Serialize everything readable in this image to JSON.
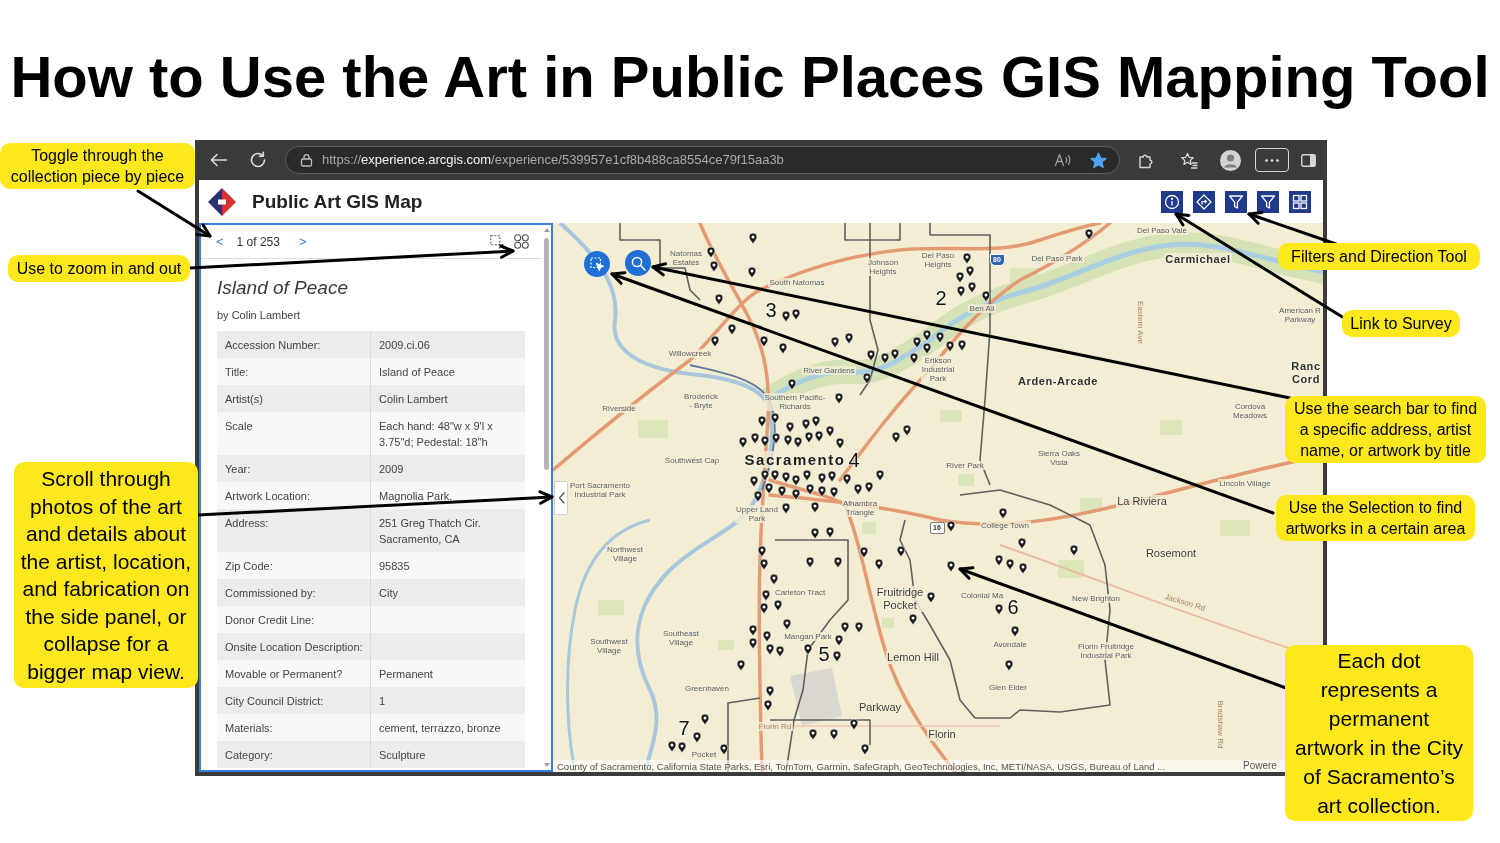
{
  "title": "How to Use the Art in Public Places GIS Mapping Tool",
  "browser": {
    "url": {
      "scheme": "https://",
      "host": "experience.arcgis.com",
      "path": "/experience/539957e1cf8b488ca8554ce79f15aa3b"
    },
    "bookmarked": true
  },
  "app": {
    "title": "Public Art GIS Map"
  },
  "panel": {
    "prev": "<",
    "position": "1 of 253",
    "next": ">",
    "artwork": {
      "title": "Island of Peace",
      "byline": "by Colin Lambert"
    },
    "fields": [
      {
        "label": "Accession Number:",
        "value": "2009.ci.06"
      },
      {
        "label": "Title:",
        "value": "Island of Peace"
      },
      {
        "label": "Artist(s)",
        "value": "Colin Lambert"
      },
      {
        "label": "Scale",
        "value": "Each hand: 48\"w x 9'l x 3.75\"d; Pedestal: 18\"h"
      },
      {
        "label": "Year:",
        "value": "2009"
      },
      {
        "label": "Artwork Location:",
        "value": "Magnolia Park."
      },
      {
        "label": "Address:",
        "value": "251 Greg Thatch Cir. Sacramento, CA"
      },
      {
        "label": "Zip Code:",
        "value": "95835"
      },
      {
        "label": "Commissioned by:",
        "value": "City"
      },
      {
        "label": "Donor Credit Line:"
      },
      {
        "label": "Onsite Location Description:"
      },
      {
        "label": "Movable or Permanent?",
        "value": "Permanent"
      },
      {
        "label": "City Council District:",
        "value": "1"
      },
      {
        "label": "Materials:",
        "value": "cement, terrazzo, bronze"
      },
      {
        "label": "Category:",
        "value": "Sculpture"
      }
    ]
  },
  "map": {
    "labels": [
      {
        "text": "Del Paso Vale",
        "kind": "place"
      },
      {
        "text": "Natomas Estates",
        "kind": "place"
      },
      {
        "text": "Johnson Heights",
        "kind": "place"
      },
      {
        "text": "Del Paso Heights",
        "kind": "place"
      },
      {
        "text": "80",
        "kind": "interstate"
      },
      {
        "text": "Del Paso Park",
        "kind": "place"
      },
      {
        "text": "Carmichael",
        "kind": "major"
      },
      {
        "text": "South Natomas",
        "kind": "place"
      },
      {
        "text": "3",
        "kind": "district"
      },
      {
        "text": "2",
        "kind": "district"
      },
      {
        "text": "Ben Ali",
        "kind": "place"
      },
      {
        "text": "Eastern Ave",
        "kind": "road"
      },
      {
        "text": "American R Parkway",
        "kind": "place"
      },
      {
        "text": "Willowcreek",
        "kind": "place"
      },
      {
        "text": "River Gardens",
        "kind": "place"
      },
      {
        "text": "Erikson Industrial Park",
        "kind": "place"
      },
      {
        "text": "Arden-Arcade",
        "kind": "major"
      },
      {
        "text": "Ranc Cord",
        "kind": "major"
      },
      {
        "text": "Riverside",
        "kind": "place"
      },
      {
        "text": "Broderick - Bryte",
        "kind": "place"
      },
      {
        "text": "Southern Pacific-Richards",
        "kind": "place"
      },
      {
        "text": "Cordova Meadows",
        "kind": "place"
      },
      {
        "text": "Southwest Cap",
        "kind": "place"
      },
      {
        "text": "Sacramento",
        "kind": "city"
      },
      {
        "text": "4",
        "kind": "district"
      },
      {
        "text": "River Park",
        "kind": "place"
      },
      {
        "text": "Sierra Oaks Vista",
        "kind": "place"
      },
      {
        "text": "Port Sacramento Industrial Park",
        "kind": "place"
      },
      {
        "text": "Lincoln Village",
        "kind": "place"
      },
      {
        "text": "Upper Land Park",
        "kind": "place"
      },
      {
        "text": "Alhambra Triangle",
        "kind": "place"
      },
      {
        "text": "La Riviera",
        "kind": "area"
      },
      {
        "text": "16",
        "kind": "route"
      },
      {
        "text": "College Town",
        "kind": "place"
      },
      {
        "text": "Northwest Village",
        "kind": "place"
      },
      {
        "text": "Rosemont",
        "kind": "area"
      },
      {
        "text": "Carleton Tract",
        "kind": "place"
      },
      {
        "text": "Fruitridge Pocket",
        "kind": "area"
      },
      {
        "text": "Colonial Ma",
        "kind": "place"
      },
      {
        "text": "6",
        "kind": "district"
      },
      {
        "text": "New Brighton",
        "kind": "place"
      },
      {
        "text": "Jackson Rd",
        "kind": "road"
      },
      {
        "text": "Southwest Village",
        "kind": "place"
      },
      {
        "text": "Southeast Village",
        "kind": "place"
      },
      {
        "text": "Mangan Park",
        "kind": "place"
      },
      {
        "text": "5",
        "kind": "district"
      },
      {
        "text": "Avondale",
        "kind": "place"
      },
      {
        "text": "Lemon Hill",
        "kind": "area"
      },
      {
        "text": "Florin Fruitridge Industrial Park",
        "kind": "place"
      },
      {
        "text": "Greenhaven",
        "kind": "place"
      },
      {
        "text": "Glen Elder",
        "kind": "place"
      },
      {
        "text": "Parkway",
        "kind": "area"
      },
      {
        "text": "7",
        "kind": "district"
      },
      {
        "text": "Florin Rd",
        "kind": "road"
      },
      {
        "text": "Florin",
        "kind": "area"
      },
      {
        "text": "Bradshaw Rd",
        "kind": "road"
      },
      {
        "text": "Pocket",
        "kind": "place"
      }
    ],
    "attribution": "County of Sacramento, California State Parks, Esri, TomTom, Garmin, SafeGraph, GeoTechnologies, Inc, METI/NASA, USGS, Bureau of Land ...",
    "powered": "Powere"
  },
  "callouts": [
    {
      "text": "Toggle through the collection piece by piece"
    },
    {
      "text": "Use to zoom in and out"
    },
    {
      "text": "Scroll through photos of the art and details about the artist, location, and fabrication on the side panel, or collapse for a bigger map view."
    },
    {
      "text": "Filters and Direction Tool"
    },
    {
      "text": "Link to Survey"
    },
    {
      "text": "Use the search bar to find a specific address, artist name, or artwork by title"
    },
    {
      "text": "Use the Selection to find artworks in a certain area"
    },
    {
      "text": "Each dot represents a permanent artwork in the City of Sacramento’s art collection."
    }
  ]
}
